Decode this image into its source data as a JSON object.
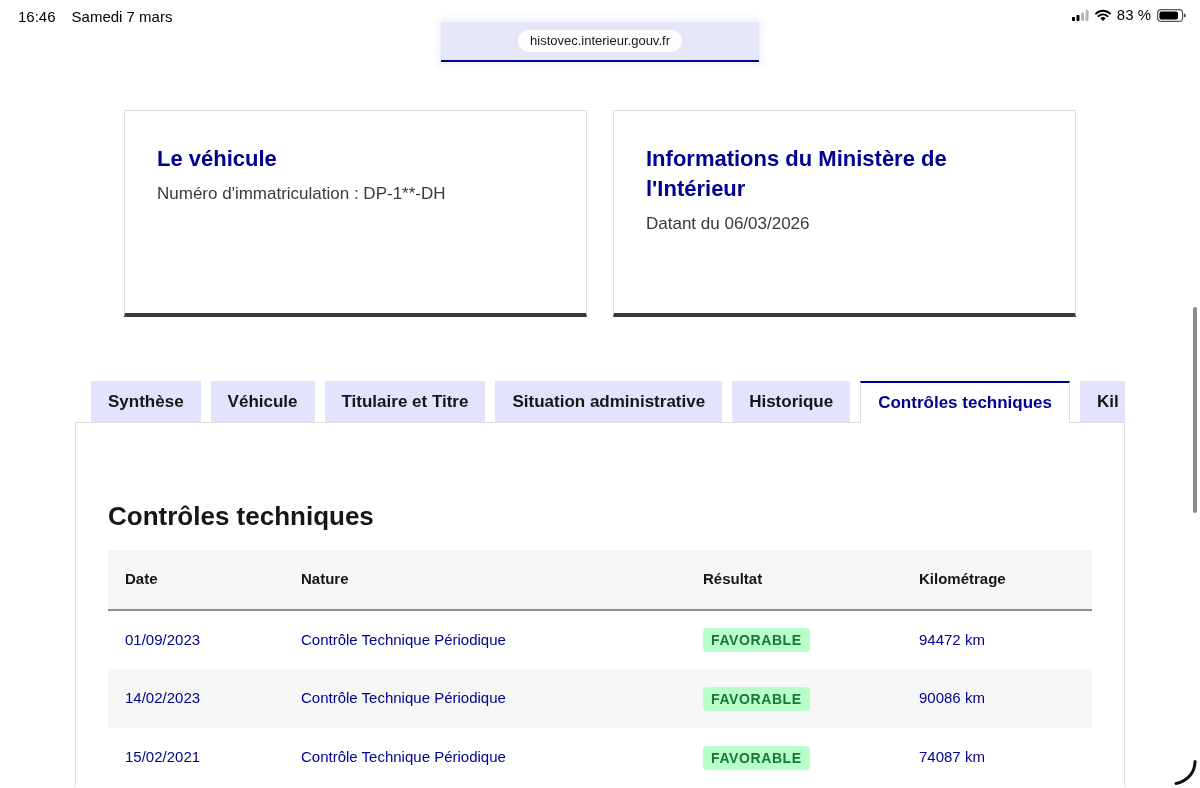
{
  "status_bar": {
    "time": "16:46",
    "date": "Samedi 7 mars",
    "battery": "83 %"
  },
  "address_bar": {
    "url": "histovec.interieur.gouv.fr"
  },
  "cards": [
    {
      "title": "Le véhicule",
      "text": "Numéro d'immatriculation : DP-1**-DH"
    },
    {
      "title": "Informations du Ministère de l'Intérieur",
      "text": "Datant du 06/03/2026"
    }
  ],
  "tabs": [
    {
      "label": "Synthèse",
      "selected": false
    },
    {
      "label": "Véhicule",
      "selected": false
    },
    {
      "label": "Titulaire et Titre",
      "selected": false
    },
    {
      "label": "Situation administrative",
      "selected": false
    },
    {
      "label": "Historique",
      "selected": false
    },
    {
      "label": "Contrôles techniques",
      "selected": true
    },
    {
      "label": "Kil",
      "selected": false
    }
  ],
  "panel": {
    "title": "Contrôles techniques",
    "table": {
      "columns": [
        "Date",
        "Nature",
        "Résultat",
        "Kilométrage"
      ],
      "rows": [
        {
          "date": "01/09/2023",
          "nature": "Contrôle Technique Périodique",
          "result": "FAVORABLE",
          "mileage": "94472 km"
        },
        {
          "date": "14/02/2023",
          "nature": "Contrôle Technique Périodique",
          "result": "FAVORABLE",
          "mileage": "90086 km"
        },
        {
          "date": "15/02/2021",
          "nature": "Contrôle Technique Périodique",
          "result": "FAVORABLE",
          "mileage": "74087 km"
        }
      ]
    }
  }
}
